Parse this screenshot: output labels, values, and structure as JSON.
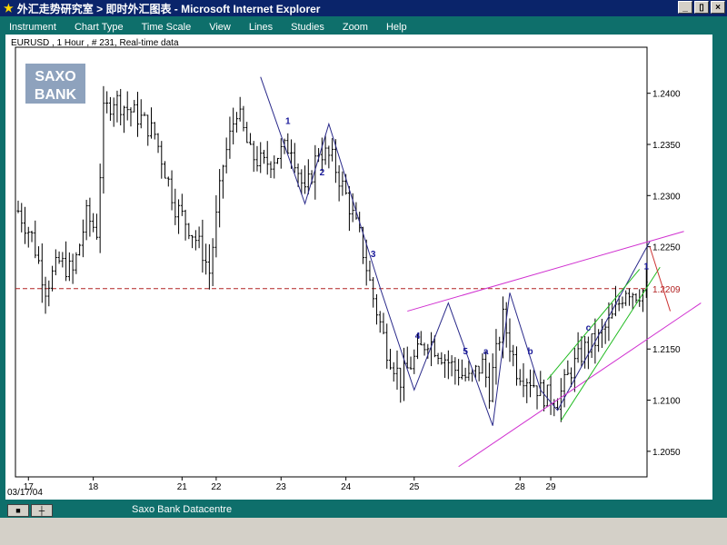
{
  "window": {
    "title": "外汇走势研究室 > 即时外汇图表 - Microsoft Internet Explorer",
    "buttons": [
      "_",
      "▯",
      "×"
    ]
  },
  "menu": [
    "Instrument",
    "Chart Type",
    "Time Scale",
    "View",
    "Lines",
    "Studies",
    "Zoom",
    "Help"
  ],
  "status": {
    "source": "Saxo Bank Datacentre"
  },
  "logo": {
    "line1": "SAXO",
    "line2": "BANK"
  },
  "chart_data": {
    "type": "candlestick",
    "title": "EURUSD , 1 Hour , # 231, Real-time data",
    "date_label": "03/17/04",
    "ylim": [
      1.2025,
      1.2445
    ],
    "y_ticks": [
      1.24,
      1.235,
      1.23,
      1.225,
      1.215,
      1.21,
      1.205
    ],
    "y_tick_labels": [
      "1.2400",
      "1.2350",
      "1.2300",
      "1.2250",
      "1.2150",
      "1.2100",
      "1.2050"
    ],
    "x_tick_labels": [
      "17",
      "18",
      "21",
      "22",
      "23",
      "24",
      "25",
      "28",
      "29"
    ],
    "x_tick_positions": [
      3,
      22,
      48,
      58,
      77,
      96,
      116,
      147,
      156
    ],
    "n_bars": 185,
    "current_price": 1.2209,
    "current_price_label": "1.2209",
    "price_path": [
      [
        0,
        1.2285
      ],
      [
        4,
        1.226
      ],
      [
        8,
        1.221
      ],
      [
        12,
        1.2235
      ],
      [
        16,
        1.2225
      ],
      [
        20,
        1.228
      ],
      [
        23,
        1.2265
      ],
      [
        25,
        1.238
      ],
      [
        28,
        1.2395
      ],
      [
        32,
        1.2385
      ],
      [
        36,
        1.2375
      ],
      [
        40,
        1.236
      ],
      [
        46,
        1.229
      ],
      [
        50,
        1.227
      ],
      [
        54,
        1.2245
      ],
      [
        56,
        1.2225
      ],
      [
        60,
        1.233
      ],
      [
        64,
        1.2385
      ],
      [
        68,
        1.234
      ],
      [
        72,
        1.233
      ],
      [
        76,
        1.234
      ],
      [
        80,
        1.235
      ],
      [
        84,
        1.23
      ],
      [
        88,
        1.2345
      ],
      [
        92,
        1.2335
      ],
      [
        96,
        1.23
      ],
      [
        100,
        1.226
      ],
      [
        104,
        1.22
      ],
      [
        108,
        1.215
      ],
      [
        112,
        1.212
      ],
      [
        116,
        1.214
      ],
      [
        120,
        1.216
      ],
      [
        124,
        1.2145
      ],
      [
        128,
        1.213
      ],
      [
        132,
        1.212
      ],
      [
        136,
        1.2135
      ],
      [
        138,
        1.211
      ],
      [
        142,
        1.218
      ],
      [
        146,
        1.213
      ],
      [
        150,
        1.212
      ],
      [
        154,
        1.2105
      ],
      [
        158,
        1.21
      ],
      [
        162,
        1.213
      ],
      [
        166,
        1.215
      ],
      [
        170,
        1.216
      ],
      [
        174,
        1.218
      ],
      [
        178,
        1.221
      ],
      [
        181,
        1.2205
      ],
      [
        184,
        1.2208
      ]
    ],
    "trendlines": [
      {
        "color": "#2a2a8a",
        "points": [
          [
            71,
            1.2416
          ],
          [
            84,
            1.2292
          ],
          [
            91,
            1.237
          ],
          [
            106,
            1.221
          ],
          [
            116,
            1.211
          ],
          [
            126,
            1.2195
          ],
          [
            139,
            1.2075
          ],
          [
            144,
            1.2205
          ],
          [
            153,
            1.211
          ],
          [
            158,
            1.209
          ],
          [
            185,
            1.2255
          ]
        ]
      },
      {
        "color": "#d030d0",
        "points": [
          [
            114,
            1.2187
          ],
          [
            195,
            1.2265
          ]
        ]
      },
      {
        "color": "#d030d0",
        "points": [
          [
            129,
            1.2035
          ],
          [
            200,
            1.2195
          ]
        ]
      },
      {
        "color": "#22bb22",
        "points": [
          [
            155,
            1.212
          ],
          [
            182,
            1.2228
          ]
        ]
      },
      {
        "color": "#22bb22",
        "points": [
          [
            159,
            1.208
          ],
          [
            188,
            1.223
          ]
        ]
      },
      {
        "color": "#cc3333",
        "points": [
          [
            185,
            1.225
          ],
          [
            191,
            1.2187
          ]
        ]
      }
    ],
    "wave_labels": [
      {
        "text": "1",
        "x": 79,
        "y": 1.237
      },
      {
        "text": "2",
        "x": 89,
        "y": 1.232
      },
      {
        "text": "3",
        "x": 104,
        "y": 1.224
      },
      {
        "text": "4",
        "x": 117,
        "y": 1.216
      },
      {
        "text": "5",
        "x": 131,
        "y": 1.2145
      },
      {
        "text": "a",
        "x": 137,
        "y": 1.2145
      },
      {
        "text": "b",
        "x": 150,
        "y": 1.2145
      },
      {
        "text": "c",
        "x": 167,
        "y": 1.2168
      },
      {
        "text": "1",
        "x": 184,
        "y": 1.2228
      }
    ]
  }
}
